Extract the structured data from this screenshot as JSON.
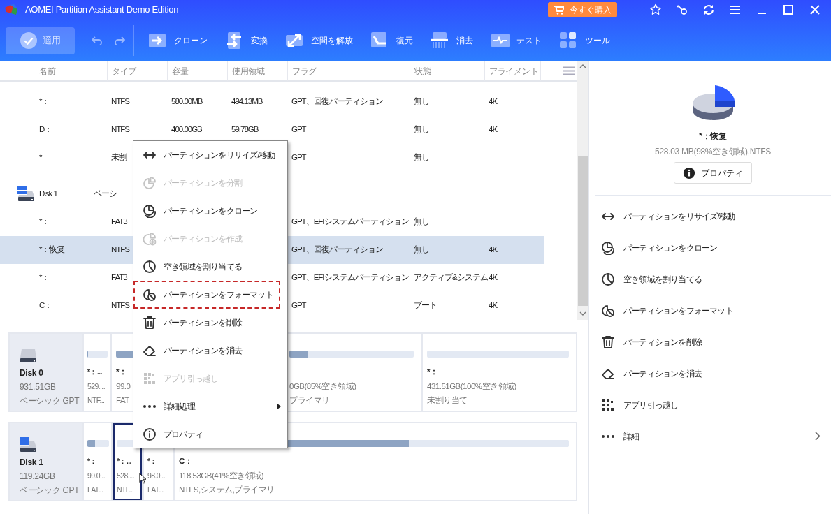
{
  "window": {
    "title": "AOMEI Partition Assistant Demo Edition"
  },
  "buy_button": {
    "label": "今すぐ購入"
  },
  "toolbar": {
    "apply": {
      "label": "適用",
      "disabled": true
    },
    "items": [
      {
        "label": "クローン"
      },
      {
        "label": "変換"
      },
      {
        "label": "空間を解放"
      },
      {
        "label": "復元"
      },
      {
        "label": "消去"
      },
      {
        "label": "テスト"
      },
      {
        "label": "ツール"
      }
    ]
  },
  "table": {
    "columns": [
      "名前",
      "タイプ",
      "容量",
      "使用領域",
      "フラグ",
      "状態",
      "アライメント"
    ],
    "rows": [
      {
        "kind": "partition",
        "selected": false,
        "cells": [
          "*：",
          "NTFS",
          "580.00MB",
          "494.13MB",
          "GPT、回復パーティション",
          "無し",
          "4K"
        ]
      },
      {
        "kind": "partition",
        "selected": false,
        "cells": [
          "D：",
          "NTFS",
          "400.00GB",
          "59.78GB",
          "GPT",
          "無し",
          "4K"
        ]
      },
      {
        "kind": "partition",
        "selected": false,
        "cells": [
          "*",
          "未割",
          null,
          null,
          "GPT",
          "無し",
          null
        ]
      },
      {
        "kind": "disk",
        "selected": false,
        "cells": [
          "Disk 1",
          "ベーシ",
          null,
          null,
          null,
          null,
          null
        ]
      },
      {
        "kind": "partition",
        "selected": false,
        "cells": [
          "*：",
          "FAT3",
          null,
          null,
          "GPT、EFIシステムパーティション",
          "無し",
          null
        ]
      },
      {
        "kind": "partition",
        "selected": true,
        "cells": [
          "*：恢复",
          "NTFS",
          null,
          null,
          "GPT、回復パーティション",
          "無し",
          "4K"
        ]
      },
      {
        "kind": "partition",
        "selected": false,
        "cells": [
          "*：",
          "FAT3",
          null,
          null,
          "GPT、EFIシステムパーティション",
          "アクティブ&システム",
          "4K"
        ]
      },
      {
        "kind": "partition",
        "selected": false,
        "cells": [
          "C：",
          "NTFS",
          null,
          null,
          "GPT",
          "ブート",
          "4K"
        ]
      }
    ]
  },
  "context_menu": {
    "items": [
      {
        "label": "パーティションをリサイズ/移動",
        "disabled": false,
        "highlighted": false,
        "has_submenu": false
      },
      {
        "label": "パーティションを分割",
        "disabled": true,
        "highlighted": false,
        "has_submenu": false
      },
      {
        "label": "パーティションをクローン",
        "disabled": false,
        "highlighted": false,
        "has_submenu": false
      },
      {
        "label": "パーティションを作成",
        "disabled": true,
        "highlighted": false,
        "has_submenu": false
      },
      {
        "label": "空き領域を割り当てる",
        "disabled": false,
        "highlighted": false,
        "has_submenu": false
      },
      {
        "label": "パーティションをフォーマット",
        "disabled": false,
        "highlighted": true,
        "has_submenu": false
      },
      {
        "label": "パーティションを削除",
        "disabled": false,
        "highlighted": false,
        "has_submenu": false
      },
      {
        "label": "パーティションを消去",
        "disabled": false,
        "highlighted": false,
        "has_submenu": false
      },
      {
        "label": "アプリ引っ越し",
        "disabled": true,
        "highlighted": false,
        "has_submenu": false
      },
      {
        "label": "詳細処理",
        "disabled": false,
        "highlighted": false,
        "has_submenu": true
      },
      {
        "label": "プロパティ",
        "disabled": false,
        "highlighted": false,
        "has_submenu": false
      }
    ]
  },
  "disk_map": {
    "disks": [
      {
        "name": "Disk 0",
        "size": "931.51GB",
        "type": "ベーシック GPT",
        "os": false,
        "partitions": [
          {
            "name": "*：...",
            "size": "529....",
            "fs": "NTF...",
            "level": 0.02,
            "selected": false
          },
          {
            "name": "*：",
            "size": "99.0",
            "fs": "FAT",
            "level": 0.3,
            "selected": false
          },
          {
            "size": "0GB(85%空き領域)",
            "fs": "プライマリ",
            "level": 0.15,
            "selected": false
          },
          {
            "name": "*：",
            "size": "431.51GB(100%空き領域)",
            "fs": "未割り当て",
            "level": 0,
            "selected": false
          }
        ]
      },
      {
        "name": "Disk 1",
        "size": "119.24GB",
        "type": "ベーシック GPT",
        "os": true,
        "partitions": [
          {
            "name": "*：",
            "size": "99.0...",
            "fs": "FAT...",
            "level": 0.35,
            "selected": false
          },
          {
            "name": "*：...",
            "size": "528....",
            "fs": "NTF...",
            "level": 0.02,
            "selected": true
          },
          {
            "name": "*：",
            "size": "98.0...",
            "fs": "FAT...",
            "selected": false
          },
          {
            "name": "C：",
            "size": "118.53GB(41%空き領域)",
            "fs": "NTFS,システム,プライマリ",
            "level": 0.59,
            "selected": false
          }
        ]
      }
    ]
  },
  "details": {
    "name": "*：恢复",
    "info": "528.03 MB(98%空き領域),NTFS",
    "button": "プロパティ",
    "actions": [
      {
        "label": "パーティションをリサイズ/移動",
        "has_submenu": false
      },
      {
        "label": "パーティションをクローン",
        "has_submenu": false
      },
      {
        "label": "空き領域を割り当てる",
        "has_submenu": false
      },
      {
        "label": "パーティションをフォーマット",
        "has_submenu": false
      },
      {
        "label": "パーティションを削除",
        "has_submenu": false
      },
      {
        "label": "パーティションを消去",
        "has_submenu": false
      },
      {
        "label": "アプリ引っ越し",
        "has_submenu": false
      },
      {
        "label": "詳細",
        "has_submenu": true
      }
    ]
  }
}
